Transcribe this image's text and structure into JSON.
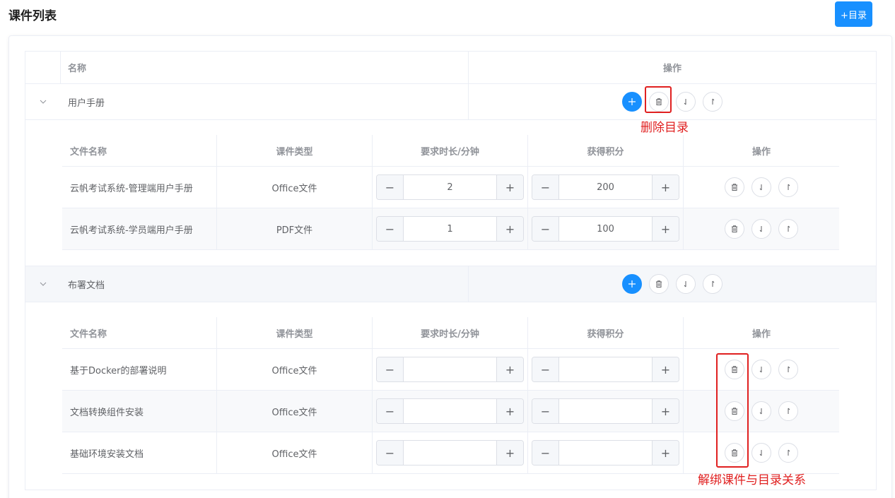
{
  "page": {
    "title": "课件列表",
    "add_directory_label": "+目录"
  },
  "table": {
    "headers": {
      "name": "名称",
      "operations": "操作"
    },
    "directories": [
      {
        "name": "用户手册",
        "files_header": {
          "file_name": "文件名称",
          "type": "课件类型",
          "duration": "要求时长/分钟",
          "points": "获得积分",
          "operations": "操作"
        },
        "files": [
          {
            "name": "云帆考试系统-管理端用户手册",
            "type": "Office文件",
            "duration": "2",
            "points": "200"
          },
          {
            "name": "云帆考试系统-学员端用户手册",
            "type": "PDF文件",
            "duration": "1",
            "points": "100"
          }
        ]
      },
      {
        "name": "布署文档",
        "files_header": {
          "file_name": "文件名称",
          "type": "课件类型",
          "duration": "要求时长/分钟",
          "points": "获得积分",
          "operations": "操作"
        },
        "files": [
          {
            "name": "基于Docker的部署说明",
            "type": "Office文件",
            "duration": "",
            "points": ""
          },
          {
            "name": "文档转换组件安装",
            "type": "Office文件",
            "duration": "",
            "points": ""
          },
          {
            "name": "基础环境安装文档",
            "type": "Office文件",
            "duration": "",
            "points": ""
          }
        ]
      }
    ]
  },
  "stepper": {
    "minus": "−",
    "plus": "+"
  },
  "annotations": {
    "delete_directory": "删除目录",
    "unbind_course": "解绑课件与目录关系"
  },
  "icons": [
    "plus-icon",
    "trash-icon",
    "arrow-down-icon",
    "arrow-up-icon",
    "chevron-down-icon"
  ],
  "colors": {
    "primary": "#1890ff",
    "annotation": "#e02020"
  }
}
